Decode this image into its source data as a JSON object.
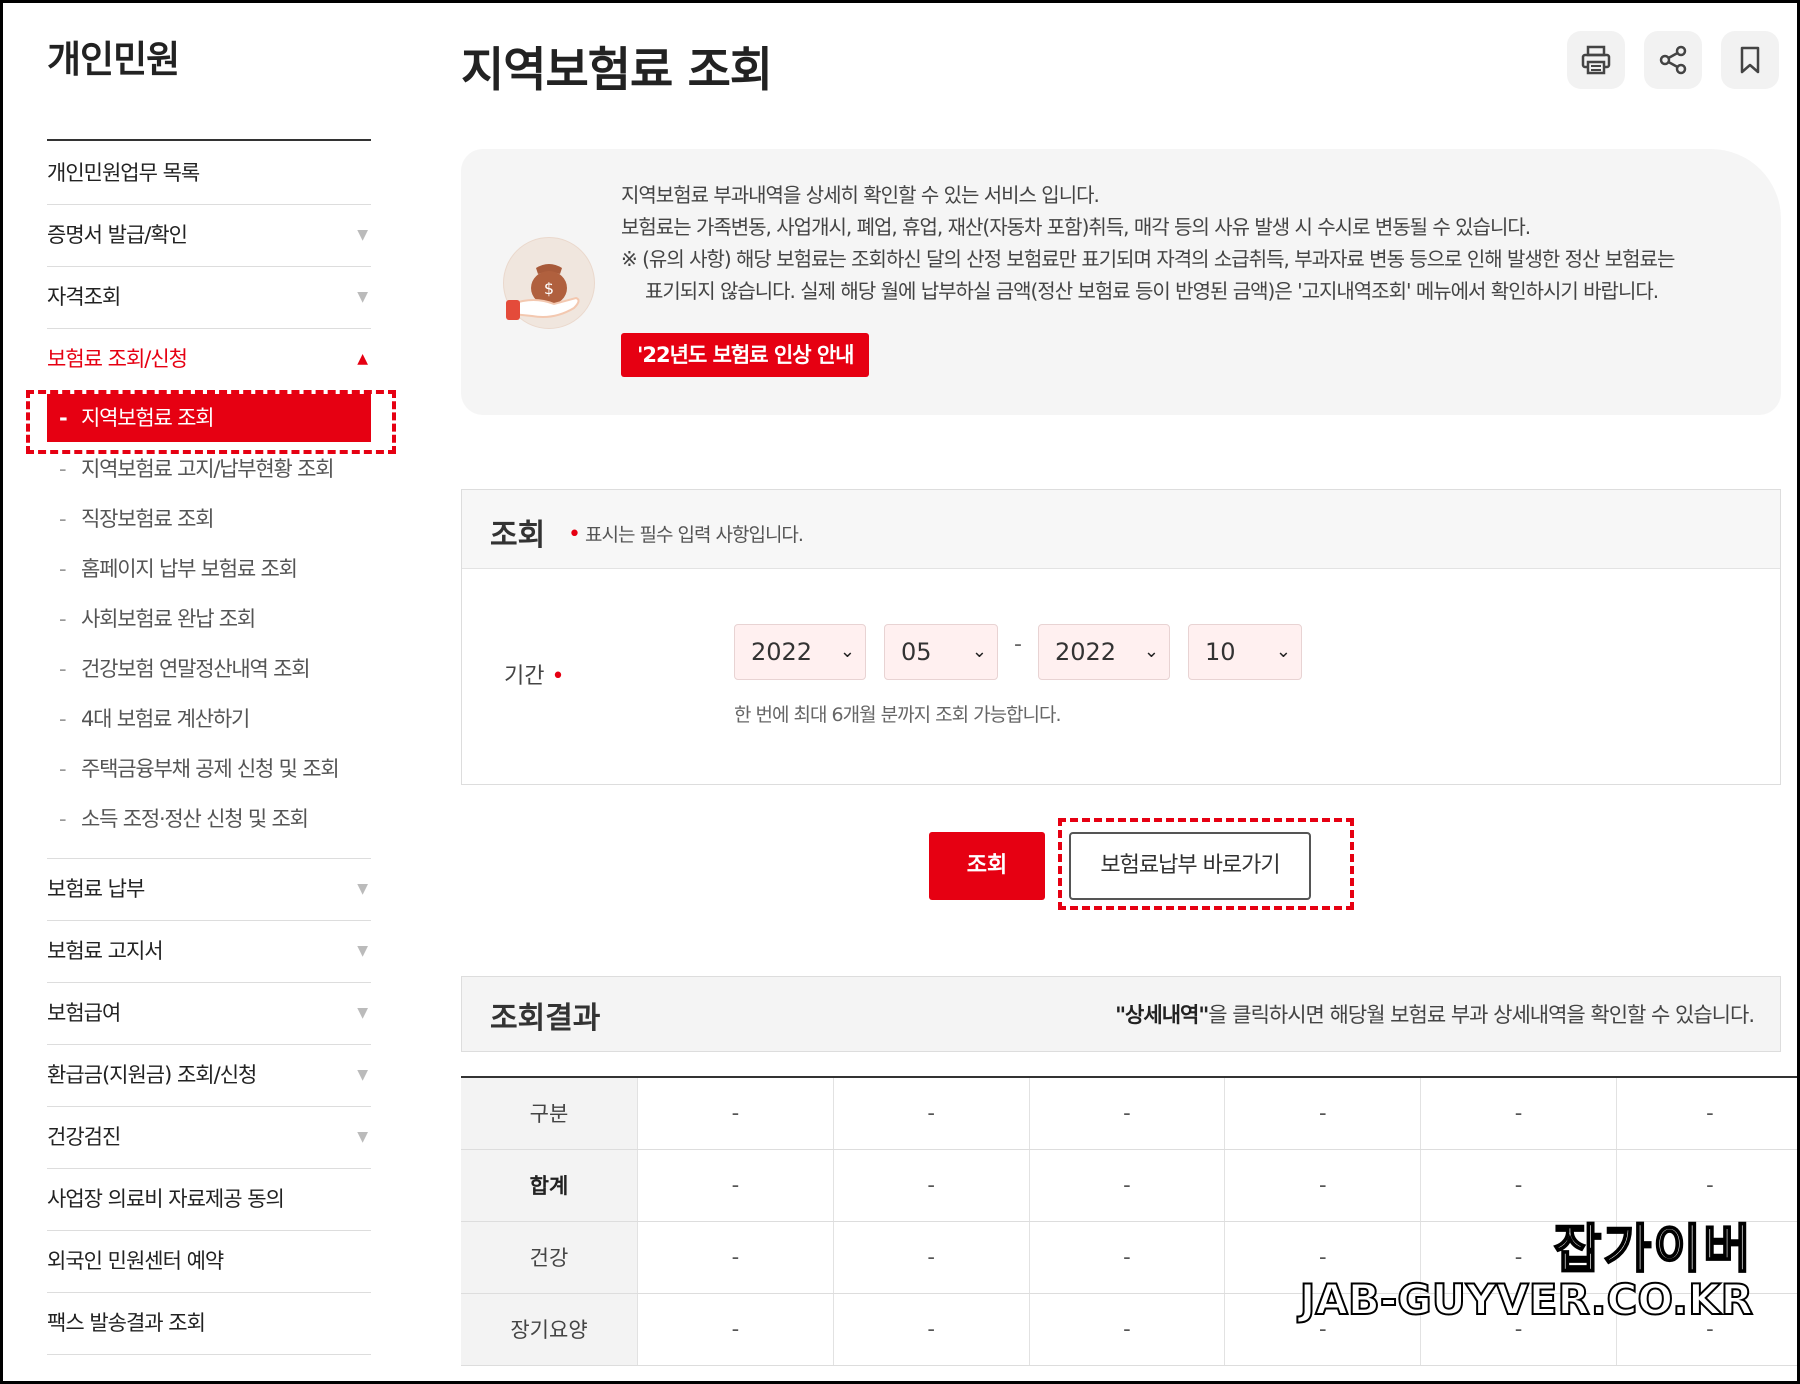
{
  "sidebar": {
    "title": "개인민원",
    "items_top": [
      {
        "label": "개인민원업무 목록",
        "arrow": ""
      },
      {
        "label": "증명서 발급/확인",
        "arrow": "▼"
      },
      {
        "label": "자격조회",
        "arrow": "▼"
      }
    ],
    "active": {
      "label": "보험료 조회/신청",
      "arrow": "▲"
    },
    "sub_items": [
      {
        "label": "지역보험료 조회",
        "dash": "-"
      },
      {
        "label": "지역보험료 고지/납부현황 조회",
        "dash": "-"
      },
      {
        "label": "직장보험료 조회",
        "dash": "-"
      },
      {
        "label": "홈페이지 납부 보험료 조회",
        "dash": "-"
      },
      {
        "label": "사회보험료 완납 조회",
        "dash": "-"
      },
      {
        "label": "건강보험 연말정산내역 조회",
        "dash": "-"
      },
      {
        "label": "4대 보험료 계산하기",
        "dash": "-"
      },
      {
        "label": "주택금융부채 공제 신청 및 조회",
        "dash": "-"
      },
      {
        "label": "소득 조정·정산 신청 및 조회",
        "dash": "-"
      }
    ],
    "items_bottom": [
      {
        "label": "보험료 납부",
        "arrow": "▼"
      },
      {
        "label": "보험료 고지서",
        "arrow": "▼"
      },
      {
        "label": "보험급여",
        "arrow": "▼"
      },
      {
        "label": "환급금(지원금) 조회/신청",
        "arrow": "▼"
      },
      {
        "label": "건강검진",
        "arrow": "▼"
      },
      {
        "label": "사업장 의료비 자료제공 동의",
        "arrow": ""
      },
      {
        "label": "외국인 민원센터 예약",
        "arrow": ""
      },
      {
        "label": "팩스 발송결과 조회",
        "arrow": ""
      }
    ]
  },
  "main": {
    "title": "지역보험료 조회",
    "tools": {
      "print": "print-icon",
      "share": "share-icon",
      "bookmark": "bookmark-icon"
    },
    "info": {
      "line1": "지역보험료 부과내역을 상세히 확인할 수 있는 서비스 입니다.",
      "line2": "보험료는 가족변동, 사업개시, 폐업, 휴업, 재산(자동차 포함)취득, 매각 등의 사유 발생 시 수시로 변동될 수 있습니다.",
      "line3": "※ (유의 사항) 해당 보험료는 조회하신 달의 산정 보험료만 표기되며 자격의 소급취득, 부과자료 변동 등으로 인해 발생한 정산 보험료는",
      "line4": "표기되지 않습니다. 실제 해당 월에 납부하실 금액(정산 보험료 등이 반영된 금액)은 '고지내역조회' 메뉴에서 확인하시기 바랍니다.",
      "button": "'22년도 보험료 인상 안내"
    },
    "search": {
      "heading": "조회",
      "required_mark": "•",
      "note": "표시는 필수 입력 사항입니다.",
      "period_label": "기간",
      "from_year": "2022",
      "from_month": "05",
      "separator": "-",
      "to_year": "2022",
      "to_month": "10",
      "hint": "한 번에 최대 6개월 분까지 조회 가능합니다."
    },
    "buttons": {
      "search": "조회",
      "pay": "보험료납부 바로가기"
    },
    "result": {
      "heading": "조회결과",
      "note_bold": "\"상세내역\"",
      "note_rest": "을 클릭하시면 해당월 보험료 부과 상세내역을 확인할 수 있습니다.",
      "rows": [
        {
          "label": "구분",
          "cells": [
            "-",
            "-",
            "-",
            "-",
            "-",
            "-"
          ]
        },
        {
          "label": "합계",
          "cells": [
            "-",
            "-",
            "-",
            "-",
            "-",
            "-"
          ]
        },
        {
          "label": "건강",
          "cells": [
            "-",
            "-",
            "-",
            "-",
            "-",
            "-"
          ]
        },
        {
          "label": "장기요양",
          "cells": [
            "-",
            "-",
            "-",
            "-",
            "-",
            "-"
          ]
        }
      ]
    }
  },
  "watermark": {
    "korean": "잡가이버",
    "url": "JAB-GUYVER.CO.KR"
  },
  "colors": {
    "accent": "#e60012",
    "select_bg": "#fff0f0",
    "panel_bg": "#f5f5f5"
  }
}
